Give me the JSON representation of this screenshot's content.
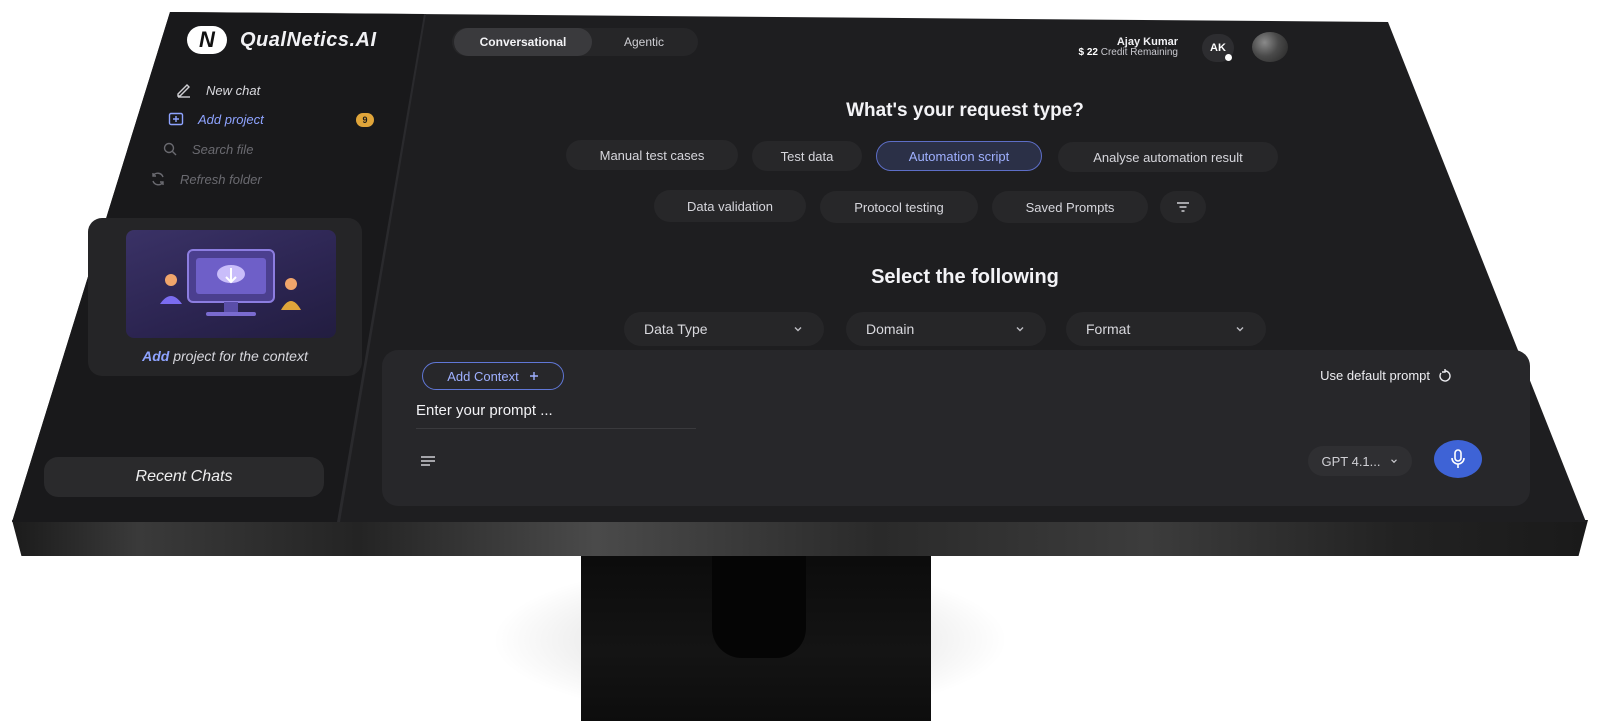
{
  "app": {
    "name": "QualNetics.AI",
    "logo_letter": "N"
  },
  "sidebar": {
    "new_chat": "New chat",
    "add_project": "Add project",
    "add_project_badge": "9",
    "search_placeholder": "Search file",
    "refresh": "Refresh folder",
    "promo": {
      "highlight": "Add",
      "text": " project for the context"
    },
    "recent_chats": "Recent Chats"
  },
  "header": {
    "modes": [
      "Conversational",
      "Agentic"
    ],
    "active_mode": "Conversational",
    "user": {
      "name": "Ajay Kumar",
      "credit_amount": "$ 22",
      "credit_label": "Credit Remaining",
      "initials": "AK"
    }
  },
  "request": {
    "title": "What's your request type?",
    "types_row1": [
      "Manual test cases",
      "Test data",
      "Automation script",
      "Analyse automation result"
    ],
    "types_row2": [
      "Data validation",
      "Protocol testing",
      "Saved Prompts"
    ],
    "active_type": "Automation script"
  },
  "selection": {
    "title": "Select the following",
    "dropdowns": [
      "Data Type",
      "Domain",
      "Format"
    ]
  },
  "composer": {
    "add_context": "Add Context",
    "default_prompt": "Use default prompt",
    "placeholder": "Enter your prompt ...",
    "model": "GPT 4.1..."
  },
  "colors": {
    "accent": "#3e63d6",
    "accent_text": "#9fb0ff",
    "badge": "#e0a53a",
    "background": "#1e1e20"
  }
}
